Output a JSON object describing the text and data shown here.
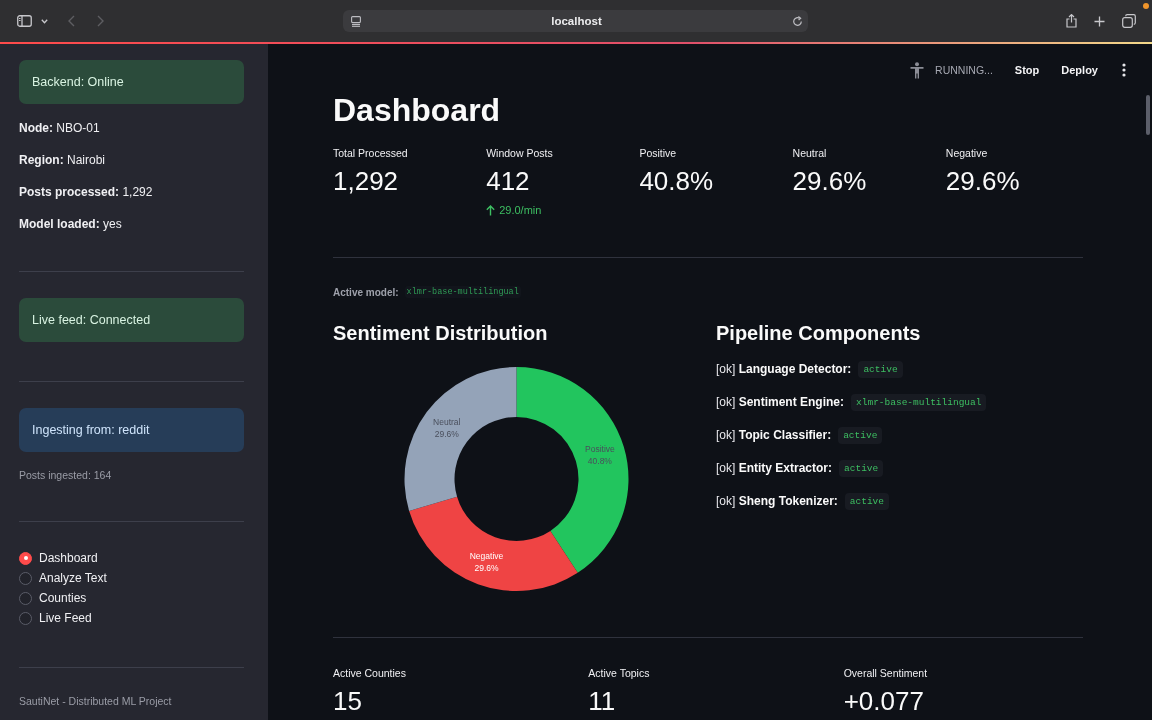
{
  "browser": {
    "address": "localhost",
    "back_enabled": false,
    "forward_enabled": false,
    "has_notification": true
  },
  "sidebar": {
    "sections": [
      {
        "blocks": [
          {
            "kind": "success_alert",
            "text": "Backend: Online"
          },
          {
            "kind": "fact",
            "text": "**Node:** NBO-01"
          },
          {
            "kind": "fact",
            "text": "**Region:** Nairobi"
          },
          {
            "kind": "fact",
            "text": "**Posts processed:** 1,292"
          },
          {
            "kind": "fact",
            "text": "**Model loaded:** yes"
          }
        ]
      },
      {
        "blocks": [
          {
            "kind": "success_alert",
            "text": "Live feed: Connected"
          }
        ]
      },
      {
        "blocks": [
          {
            "kind": "info_alert",
            "text": "Ingesting from: reddit"
          },
          {
            "kind": "caption",
            "text": "Posts ingested: 164"
          }
        ]
      },
      {
        "blocks": [
          {
            "kind": "radio_group",
            "options": [
              {
                "label": "Dashboard",
                "selected": true
              },
              {
                "label": "Analyze Text",
                "selected": false
              },
              {
                "label": "Counties",
                "selected": false
              },
              {
                "label": "Live Feed",
                "selected": false
              }
            ]
          }
        ]
      },
      {
        "blocks": [
          {
            "kind": "caption",
            "text": "SautiNet - Distributed ML Project"
          }
        ]
      }
    ]
  },
  "app_header": {
    "status": "RUNNING...",
    "actions": [
      "Stop",
      "Deploy"
    ]
  },
  "page": {
    "title": "Dashboard",
    "top_metrics": [
      {
        "label": "Total Processed",
        "value": "1,292"
      },
      {
        "label": "Window Posts",
        "value": "412",
        "delta": {
          "text": "29.0/min",
          "kind": "increase"
        }
      },
      {
        "label": "Positive",
        "value": "40.8%"
      },
      {
        "label": "Neutral",
        "value": "29.6%"
      },
      {
        "label": "Negative",
        "value": "29.6%"
      }
    ],
    "active_model": {
      "label": "Active model:",
      "value": "xlmr-base-multilingual"
    },
    "sentiment_distribution": {
      "title": "Sentiment Distribution",
      "chart_data": {
        "type": "donut",
        "categories": [
          "Positive",
          "Negative",
          "Neutral"
        ],
        "values": [
          40.8,
          29.6,
          29.6
        ],
        "colors": [
          "#22c55e",
          "#ef4444",
          "#94a3b8"
        ],
        "value_labels": [
          "40.8%",
          "29.6%",
          "29.6%"
        ]
      }
    },
    "pipeline_components": {
      "title": "Pipeline Components",
      "items": [
        {
          "text": "[ok] **Language Detector:**",
          "status": "active"
        },
        {
          "text": "[ok] **Sentiment Engine:**",
          "status": "xlmr-base-multilingual"
        },
        {
          "text": "[ok] **Topic Classifier:**",
          "status": "active"
        },
        {
          "text": "[ok] **Entity Extractor:**",
          "status": "active"
        },
        {
          "text": "[ok] **Sheng Tokenizer:**",
          "status": "active"
        }
      ]
    },
    "bottom_metrics": [
      {
        "label": "Active Counties",
        "value": "15"
      },
      {
        "label": "Active Topics",
        "value": "11"
      },
      {
        "label": "Overall Sentiment",
        "value": "+0.077"
      }
    ]
  }
}
